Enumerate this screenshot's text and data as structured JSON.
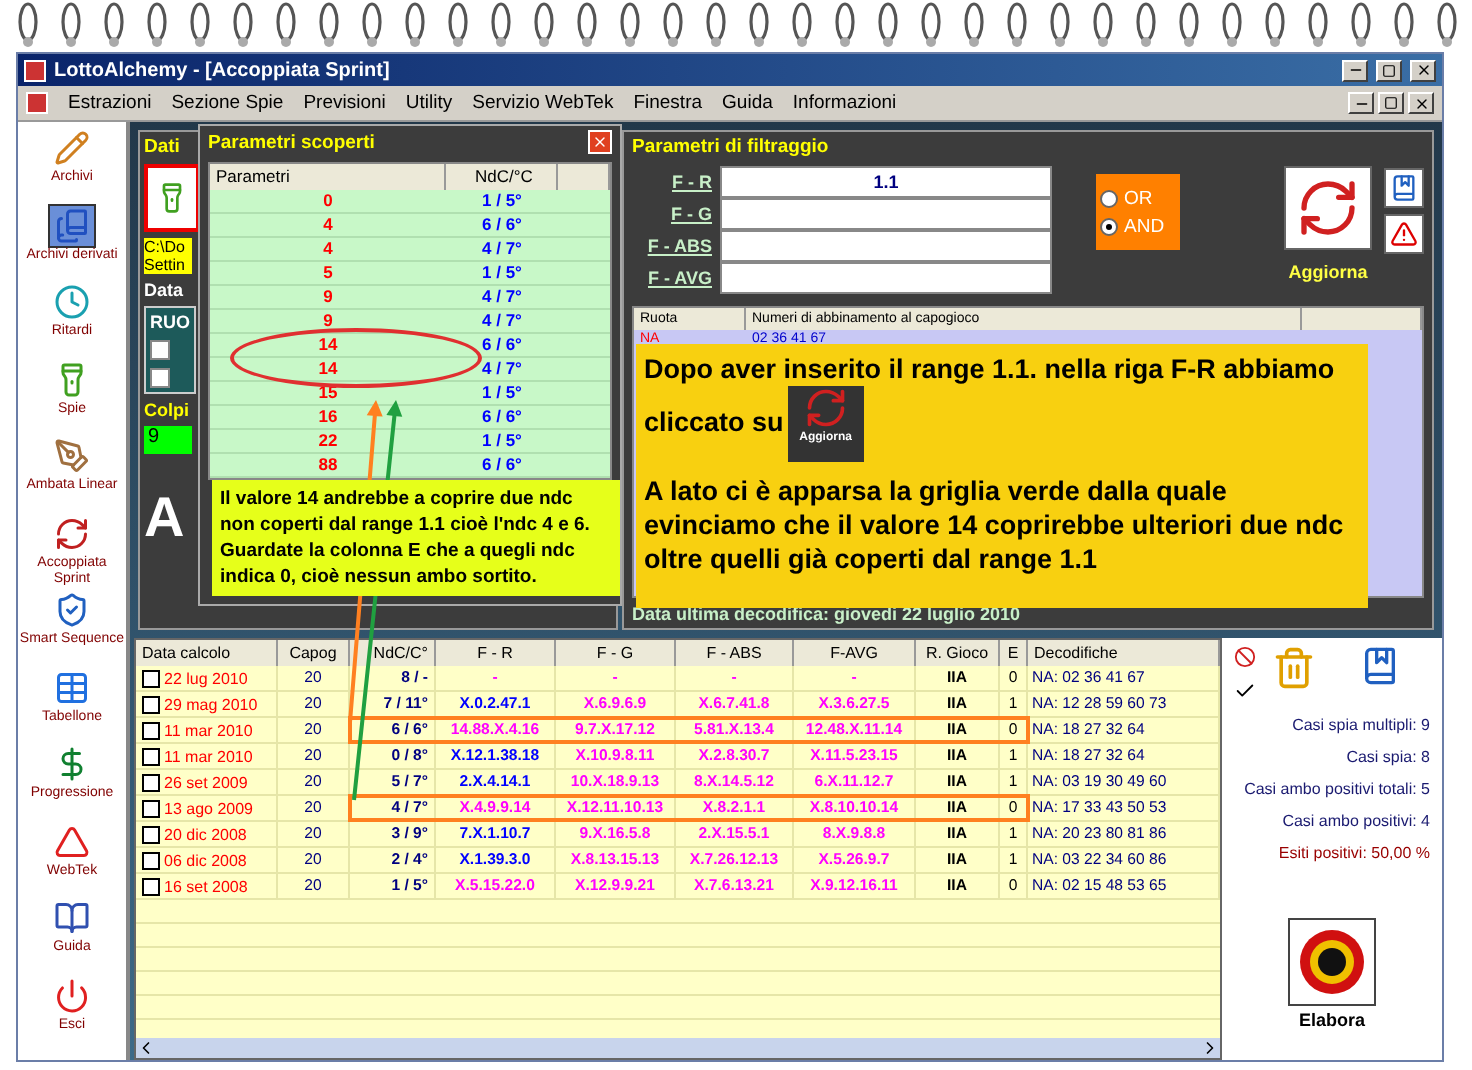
{
  "window": {
    "title": "LottoAlchemy - [Accoppiata Sprint]"
  },
  "menu": [
    "Estrazioni",
    "Sezione Spie",
    "Previsioni",
    "Utility",
    "Servizio WebTek",
    "Finestra",
    "Guida",
    "Informazioni"
  ],
  "sidebar": {
    "items": [
      {
        "label": "Archivi",
        "selected": false
      },
      {
        "label": "Archivi derivati",
        "selected": true
      },
      {
        "label": "Ritardi",
        "selected": false
      },
      {
        "label": "Spie",
        "selected": false
      },
      {
        "label": "Ambata Linear",
        "selected": false
      },
      {
        "label": "Accoppiata Sprint",
        "selected": false
      },
      {
        "label": "Smart Sequence",
        "selected": false
      },
      {
        "label": "Tabellone",
        "selected": false
      },
      {
        "label": "Progressione",
        "selected": false
      },
      {
        "label": "WebTek",
        "selected": false
      },
      {
        "label": "Guida",
        "selected": false
      },
      {
        "label": "Esci",
        "selected": false
      }
    ]
  },
  "dati_panel": {
    "title": "Dati",
    "path_lines": [
      "C:\\Do",
      "Settin"
    ],
    "data_label": "Data",
    "ruote_label": "RUO",
    "colpi_label": "Colpi",
    "colpi_value": "9",
    "banner_letter": "A"
  },
  "popup": {
    "title": "Parametri scoperti",
    "columns": [
      "Parametri",
      "NdC/°C"
    ],
    "rows": [
      {
        "param": "0",
        "ndc": "1 / 5°",
        "circled": false
      },
      {
        "param": "4",
        "ndc": "6 / 6°",
        "circled": false
      },
      {
        "param": "4",
        "ndc": "4 / 7°",
        "circled": false
      },
      {
        "param": "5",
        "ndc": "1 / 5°",
        "circled": false
      },
      {
        "param": "9",
        "ndc": "4 / 7°",
        "circled": false
      },
      {
        "param": "9",
        "ndc": "4 / 7°",
        "circled": false
      },
      {
        "param": "14",
        "ndc": "6 / 6°",
        "circled": true
      },
      {
        "param": "14",
        "ndc": "4 / 7°",
        "circled": true
      },
      {
        "param": "15",
        "ndc": "1 / 5°",
        "circled": false
      },
      {
        "param": "16",
        "ndc": "6 / 6°",
        "circled": false
      },
      {
        "param": "22",
        "ndc": "1 / 5°",
        "circled": false
      },
      {
        "param": "88",
        "ndc": "6 / 6°",
        "circled": false
      }
    ],
    "note": "Il valore 14 andrebbe a coprire due ndc non coperti dal range 1.1 cioè l'ndc 4 e 6. Guardate la colonna E che a quegli ndc indica 0, cioè nessun ambo sortito."
  },
  "filter_panel": {
    "title": "Parametri di filtraggio",
    "fields": [
      {
        "label": "F - R",
        "value": "1.1"
      },
      {
        "label": "F - G"
      },
      {
        "label": "F - ABS"
      },
      {
        "label": "F - AVG"
      }
    ],
    "logic": [
      {
        "label": "OR",
        "selected": false
      },
      {
        "label": "AND",
        "selected": true
      }
    ],
    "refresh_button": "Aggiorna",
    "grid_columns": [
      "Ruota",
      "Numeri di abbinamento al capogioco"
    ],
    "grid_rows": [
      {
        "ruota": "NA",
        "numbers": "02 36 41 67"
      }
    ],
    "note_lines": [
      "Dopo aver inserito il range 1.1. nella riga F-R abbiamo cliccato su",
      "A lato ci è apparsa la griglia verde dalla quale evinciamo che il valore 14 coprirebbe ulteriori due ndc oltre quelli già coperti dal range 1.1"
    ],
    "note_button": "Aggiorna",
    "footer": "Data ultima decodifica: giovedi 22 luglio 2010"
  },
  "table": {
    "columns": [
      "Data calcolo",
      "Capog",
      "NdC/C°",
      "F - R",
      "F - G",
      "F - ABS",
      "F-AVG",
      "R. Gioco",
      "E",
      "Decodifiche"
    ],
    "rows": [
      {
        "checked": false,
        "highlighted": false,
        "color": "#ff00ff",
        "cells": [
          "22 lug 2010",
          "20",
          "8 / -",
          "-",
          "-",
          "-",
          "-",
          "IIA",
          "0",
          "NA: 02 36 41 67"
        ]
      },
      {
        "checked": false,
        "highlighted": false,
        "color": "#0000ff",
        "cells": [
          "29 mag 2010",
          "20",
          "7 / 11°",
          "X.0.2.47.1",
          "X.6.9.6.9",
          "X.6.7.41.8",
          "X.3.6.27.5",
          "IIA",
          "1",
          "NA: 12 28 59 60 73"
        ]
      },
      {
        "checked": false,
        "highlighted": true,
        "color": "#ff00ff",
        "cells": [
          "11 mar 2010",
          "20",
          "6 / 6°",
          "14.88.X.4.16",
          "9.7.X.17.12",
          "5.81.X.13.4",
          "12.48.X.11.14",
          "IIA",
          "0",
          "NA: 18 27 32 64"
        ]
      },
      {
        "checked": false,
        "highlighted": false,
        "color": "#0000ff",
        "cells": [
          "11 mar 2010",
          "20",
          "0 / 8°",
          "X.12.1.38.18",
          "X.10.9.8.11",
          "X.2.8.30.7",
          "X.11.5.23.15",
          "IIA",
          "1",
          "NA: 18 27 32 64"
        ]
      },
      {
        "checked": false,
        "highlighted": false,
        "color": "#0000ff",
        "cells": [
          "26 set 2009",
          "20",
          "5 / 7°",
          "2.X.4.14.1",
          "10.X.18.9.13",
          "8.X.14.5.12",
          "6.X.11.12.7",
          "IIA",
          "1",
          "NA: 03 19 30 49 60"
        ]
      },
      {
        "checked": false,
        "highlighted": true,
        "color": "#ff00ff",
        "cells": [
          "13 ago 2009",
          "20",
          "4 / 7°",
          "X.4.9.9.14",
          "X.12.11.10.13",
          "X.8.2.1.1",
          "X.8.10.10.14",
          "IIA",
          "0",
          "NA: 17 33 43 50 53"
        ]
      },
      {
        "checked": false,
        "highlighted": false,
        "color": "#0000ff",
        "cells": [
          "20 dic 2008",
          "20",
          "3 / 9°",
          "7.X.1.10.7",
          "9.X.16.5.8",
          "2.X.15.5.1",
          "8.X.9.8.8",
          "IIA",
          "1",
          "NA: 20 23 80 81 86"
        ]
      },
      {
        "checked": false,
        "highlighted": false,
        "color": "#0000ff",
        "cells": [
          "06 dic 2008",
          "20",
          "2 / 4°",
          "X.1.39.3.0",
          "X.8.13.15.13",
          "X.7.26.12.13",
          "X.5.26.9.7",
          "IIA",
          "1",
          "NA: 03 22 34 60 86"
        ]
      },
      {
        "checked": false,
        "highlighted": false,
        "color": "#ff00ff",
        "cells": [
          "16 set 2008",
          "20",
          "1 / 5°",
          "X.5.15.22.0",
          "X.12.9.9.21",
          "X.7.6.13.21",
          "X.9.12.16.11",
          "IIA",
          "0",
          "NA: 02 15 48 53 65"
        ]
      }
    ]
  },
  "stats": [
    {
      "text": "Casi spia multipli: 9",
      "kind": "normal"
    },
    {
      "text": "Casi spia: 8",
      "kind": "normal"
    },
    {
      "text": "Casi ambo positivi totali: 5",
      "kind": "normal"
    },
    {
      "text": "Casi ambo positivi: 4",
      "kind": "normal"
    },
    {
      "text": "Esiti positivi: 50,00 %",
      "kind": "result"
    }
  ],
  "run_button": "Elabora"
}
